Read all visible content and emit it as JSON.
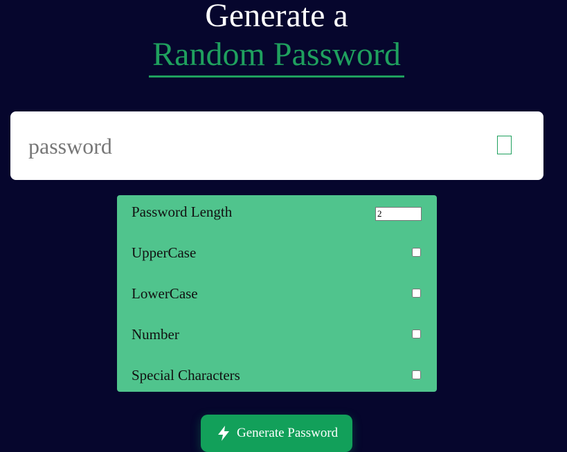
{
  "header": {
    "title_line1": "Generate a",
    "title_line2": "Random Password"
  },
  "password_display": {
    "placeholder": "password",
    "value": "",
    "copy_icon": "copy-icon"
  },
  "options": {
    "length": {
      "label": "Password Length",
      "value": "2"
    },
    "uppercase": {
      "label": "UpperCase",
      "checked": false
    },
    "lowercase": {
      "label": "LowerCase",
      "checked": false
    },
    "number": {
      "label": "Number",
      "checked": false
    },
    "special": {
      "label": "Special Characters",
      "checked": false
    }
  },
  "generate_button": {
    "label": "Generate Password",
    "icon": "lightning-bolt-icon"
  },
  "colors": {
    "background": "#06062d",
    "accent": "#1fa05e",
    "panel": "#50c48d",
    "button": "#12a05a"
  }
}
